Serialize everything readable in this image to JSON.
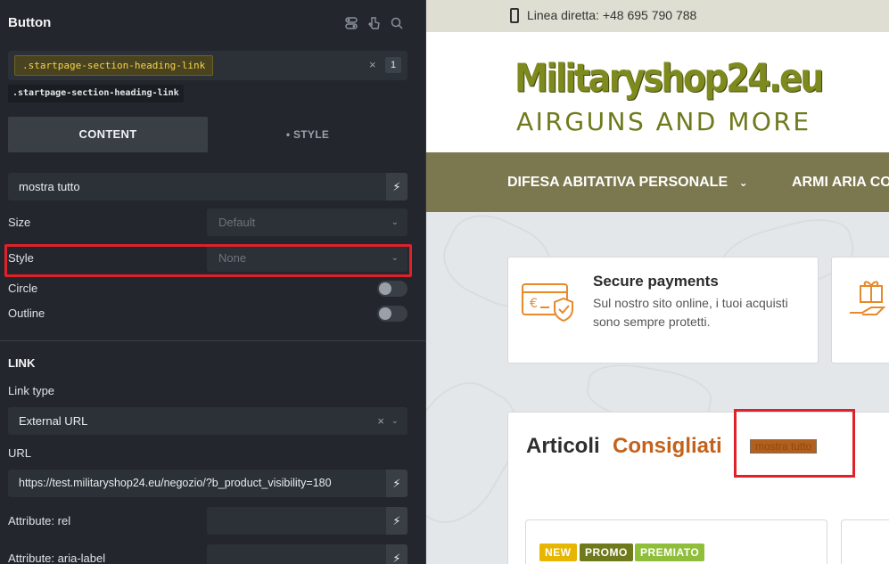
{
  "panel": {
    "title": "Button",
    "header_icons": [
      "toggle-icon",
      "pointer-icon",
      "search-icon"
    ],
    "class_selector": ".startpage-section-heading-link",
    "class_count": "1",
    "class_remove": "×",
    "class_tag": ".startpage-section-heading-link",
    "tabs": {
      "content": "CONTENT",
      "style": "• STYLE"
    },
    "text_value": "mostra tutto",
    "size": {
      "label": "Size",
      "value": "Default"
    },
    "style": {
      "label": "Style",
      "value": "None"
    },
    "circle": {
      "label": "Circle",
      "enabled": false
    },
    "outline": {
      "label": "Outline",
      "enabled": false
    },
    "link": {
      "heading": "LINK",
      "link_type_label": "Link type",
      "link_type_value": "External URL",
      "url_label": "URL",
      "url_value": "https://test.militaryshop24.eu/negozio/?b_product_visibility=180",
      "attr_rel_label": "Attribute: rel",
      "attr_aria_label": "Attribute: aria-label"
    },
    "bolt": "⚡",
    "chevron": "⌄",
    "clear": "×"
  },
  "site": {
    "topbar_text": "Linea diretta: +48 695 790 788",
    "logo_main": "Militaryshop24.eu",
    "logo_sub": "AIRGUNS AND MORE",
    "nav": [
      "DIFESA ABITATIVA PERSONALE",
      "ARMI ARIA CO"
    ],
    "nav_chevron": "⌄",
    "payments": {
      "title": "Secure payments",
      "text": "Sul nostro sito online, i tuoi acquisti sono sempre protetti."
    },
    "articles": {
      "title_a": "Articoli",
      "title_b": "Consigliati",
      "button": "mostra tutto"
    },
    "badges": [
      {
        "label": "NEW",
        "color": "#e7b600"
      },
      {
        "label": "PROMO",
        "color": "#6e7a1c"
      },
      {
        "label": "PREMIATO",
        "color": "#8fbf3a"
      }
    ]
  },
  "colors": {
    "accent_orange": "#c4621b",
    "nav_bg": "#7b774f",
    "highlight_red": "#e0202a"
  }
}
